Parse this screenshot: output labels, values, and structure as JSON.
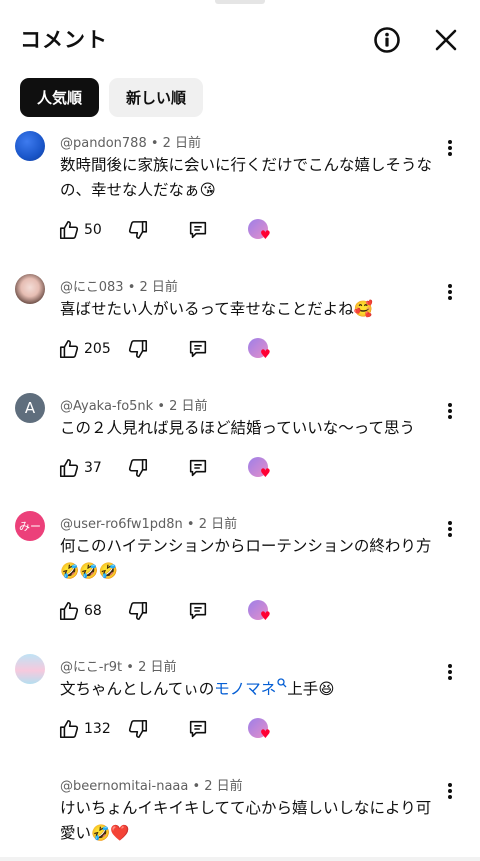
{
  "header": {
    "title": "コメント"
  },
  "chips": [
    {
      "label": "人気順"
    },
    {
      "label": "新しい順"
    }
  ],
  "comments": [
    {
      "author": "@pandon788",
      "time": "2 日前",
      "text_1": "数時間後に家族に会いに行くだけでこんな嬉しそうな",
      "text_2": "の、幸せな人だなぁ",
      "emoji": "😘",
      "likes": "50",
      "avatar_color": "#1a56c9"
    },
    {
      "author": "@にこ083",
      "time": "2 日前",
      "text_1": "喜ばせたい人がいるって幸せなことだよね",
      "emoji": "🥰",
      "likes": "205"
    },
    {
      "author": "@Ayaka-fo5nk",
      "time": "2 日前",
      "text_1": "この２人見れば見るほど結婚っていいな〜って思う",
      "likes": "37",
      "avatar_letter": "A",
      "avatar_color": "#5f6e7d"
    },
    {
      "author": "@user-ro6fw1pd8n",
      "time": "2 日前",
      "text_1": "何このハイテンションからローテンションの終わり方",
      "emoji": "🤣🤣🤣",
      "likes": "68",
      "avatar_letter": "みー",
      "avatar_color": "#ec407a"
    },
    {
      "author": "@にこ-r9t",
      "time": "2 日前",
      "text_pre": "文ちゃんとしんてぃの",
      "text_link": "モノマネ",
      "text_post": "上手",
      "emoji": "😆",
      "likes": "132"
    },
    {
      "author": "@beernomitai-naaa",
      "time": "2 日前",
      "text_1": "けいちょんイキイキしてて心から嬉しいしなにより可",
      "text_2": "愛い",
      "emoji": "🤣❤️"
    }
  ],
  "icons": {
    "info": "info-icon",
    "close": "close-icon",
    "menu": "more-vert-icon",
    "like": "thumb-up-icon",
    "dislike": "thumb-down-icon",
    "reply": "reply-icon"
  }
}
